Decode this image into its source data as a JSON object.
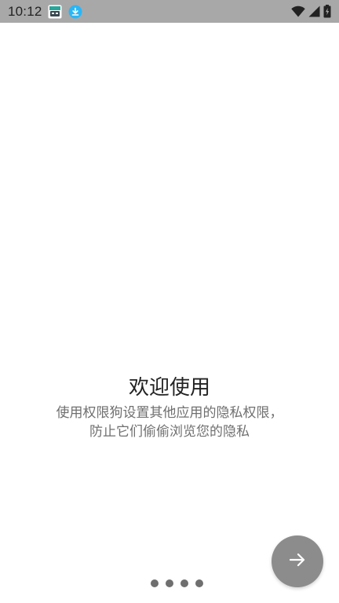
{
  "status_bar": {
    "time": "10:12",
    "app_icon": "app-notification-icon",
    "download_icon": "download-icon",
    "wifi_icon": "wifi-icon",
    "signal_icon": "cell-signal-icon",
    "battery_icon": "battery-charging-icon"
  },
  "welcome": {
    "title": "欢迎使用",
    "description_line1": "使用权限狗设置其他应用的隐私权限，",
    "description_line2": "防止它们偷偷浏览您的隐私"
  },
  "pager": {
    "page_count": 4,
    "current_page": 1
  },
  "next_button": {
    "icon": "arrow-right-icon"
  },
  "colors": {
    "status_bar_bg": "#a8a8a8",
    "title_text": "#222222",
    "desc_text": "#6f6f6f",
    "fab_bg": "#8c8c8c",
    "download_accent": "#29b6f6",
    "app_icon_accent": "#26a69a"
  }
}
